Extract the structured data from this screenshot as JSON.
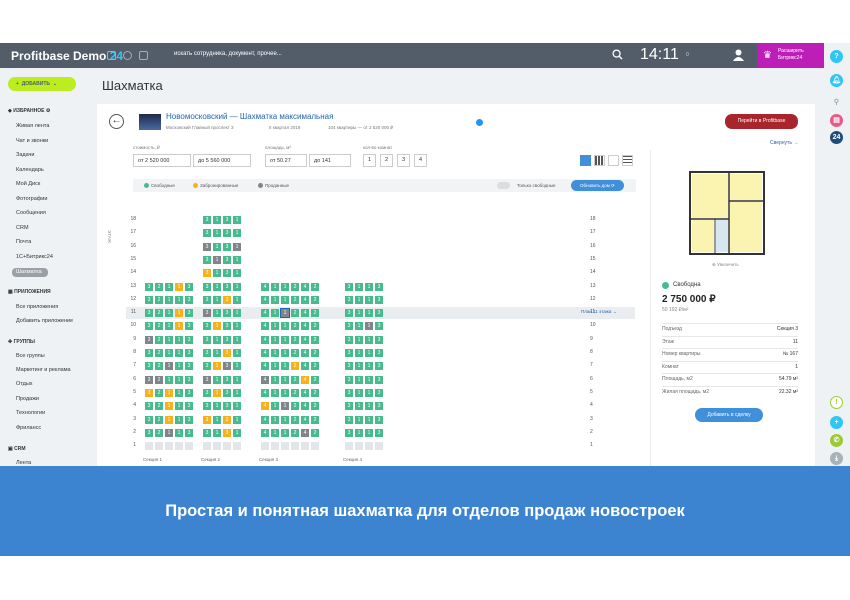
{
  "topbar": {
    "brand": "Profitbase Demo",
    "brand_num": "24",
    "search_placeholder": "искать сотрудника, документ, прочее...",
    "clock": "14:11",
    "clock_sub": "0",
    "expand_line1": "Расширить",
    "expand_line2": "Битрикс24"
  },
  "rightbar": {
    "help": "?",
    "b24": "24"
  },
  "sidebar": {
    "add_label": "ДОБАВИТЬ",
    "fav_head": "ИЗБРАННОЕ",
    "fav_items": [
      "Живая лента",
      "Чат и звонки",
      "Задачи",
      "Календарь",
      "Мой Диск",
      "Фотографии",
      "Сообщения",
      "CRM",
      "Почта",
      "1С+Битрикс24",
      "Шахматка"
    ],
    "apps_head": "ПРИЛОЖЕНИЯ",
    "apps_items": [
      "Все приложения",
      "Добавить приложение"
    ],
    "groups_head": "ГРУППЫ",
    "groups_items": [
      "Все группы",
      "Маркетинг и реклама",
      "Отдых",
      "Продажи",
      "Технологии",
      "Фрилансс"
    ],
    "crm_head": "CRM",
    "crm_items": [
      "Лента"
    ]
  },
  "page_title": "Шахматка",
  "project": {
    "title": "Новомосковский — Шахматка максимальная",
    "address": "Московский Главный проспект 3",
    "quarter": "II квартал 2019",
    "count": "104 квартиры",
    "from_price": "— от 2 520 000 ₽",
    "go_label": "Перейти в Profitbase",
    "collapse": "Свернуть"
  },
  "filters": {
    "cost_label": "стоимость, ₽",
    "cost_from": "от  2 520 000",
    "cost_to": "до  5 560 000",
    "area_label": "площадь, м²",
    "area_from": "от  50.27",
    "area_to": "до  141",
    "rooms_label": "кол-во комнат",
    "rooms": [
      "1",
      "2",
      "3",
      "4"
    ]
  },
  "legend": {
    "free": "Свободные",
    "reserved": "Забронированные",
    "sold": "Проданные",
    "only_free": "Только свободные",
    "update": "Обновить дом"
  },
  "colors": {
    "free": "#47ba8e",
    "reserved": "#f7b11c",
    "sold": "#7f8589",
    "empty": "#e3e6e9",
    "accent": "#3f8fda",
    "brand": "#bd1eb8",
    "banner": "#3d84d0"
  },
  "grid": {
    "floors_label": "ЭТАЖ",
    "floors": [
      "18",
      "17",
      "16",
      "15",
      "14",
      "13",
      "12",
      "11",
      "10",
      "9",
      "8",
      "7",
      "6",
      "5",
      "4",
      "3",
      "2",
      "1"
    ],
    "plan_label": "План 11 этажа  →",
    "sections": [
      "Секция 1",
      "Секция 2",
      "Секция 3",
      "Секция 4"
    ],
    "s1": [
      [],
      [],
      [],
      [],
      [],
      [
        "F3",
        "F2",
        "F1",
        "R1",
        "F3"
      ],
      [
        "F3",
        "F2",
        "F1",
        "F1",
        "F3"
      ],
      [
        "F3",
        "F2",
        "F1",
        "R1",
        "F3"
      ],
      [
        "F3",
        "F2",
        "F1",
        "R1",
        "F3"
      ],
      [
        "S3",
        "F2",
        "F1",
        "F1",
        "F3"
      ],
      [
        "F3",
        "F2",
        "F1",
        "F1",
        "F3"
      ],
      [
        "F3",
        "F2",
        "S1",
        "F1",
        "F3"
      ],
      [
        "S3",
        "S2",
        "F1",
        "F1",
        "F3"
      ],
      [
        "R3",
        "F2",
        "R1",
        "F1",
        "F3"
      ],
      [
        "F3",
        "F2",
        "R1",
        "F1",
        "F3"
      ],
      [
        "F3",
        "F2",
        "R1",
        "F1",
        "F3"
      ],
      [
        "F3",
        "F2",
        "S1",
        "F1",
        "F3"
      ],
      [
        "E",
        "E",
        "E",
        "E",
        "E"
      ]
    ],
    "s2": [
      [
        "F3",
        "F1",
        "F3",
        "F1"
      ],
      [
        "F3",
        "F1",
        "F3",
        "F1"
      ],
      [
        "S3",
        "F1",
        "F3",
        "S1"
      ],
      [
        "F3",
        "S1",
        "F3",
        "F1"
      ],
      [
        "R3",
        "F1",
        "F3",
        "F1"
      ],
      [
        "F3",
        "F1",
        "F3",
        "F1"
      ],
      [
        "F3",
        "F1",
        "R3",
        "F1"
      ],
      [
        "S3",
        "F1",
        "F3",
        "F1"
      ],
      [
        "F3",
        "R1",
        "F3",
        "F1"
      ],
      [
        "F3",
        "F1",
        "F3",
        "F1"
      ],
      [
        "F3",
        "F1",
        "R3",
        "F1"
      ],
      [
        "F3",
        "R1",
        "S3",
        "F1"
      ],
      [
        "S3",
        "F1",
        "F3",
        "F1"
      ],
      [
        "F3",
        "R1",
        "F3",
        "F1"
      ],
      [
        "F3",
        "F1",
        "F3",
        "F1"
      ],
      [
        "R3",
        "F1",
        "R3",
        "F1"
      ],
      [
        "F3",
        "F1",
        "R3",
        "F1"
      ],
      [
        "E",
        "E",
        "E",
        "E"
      ]
    ],
    "s3": [
      [],
      [],
      [],
      [],
      [],
      [
        "F4",
        "F1",
        "F1",
        "F2",
        "F4",
        "F2"
      ],
      [
        "F4",
        "F1",
        "F1",
        "F2",
        "F4",
        "F2"
      ],
      [
        "F4",
        "F1",
        "S1",
        "F2",
        "F4",
        "F2"
      ],
      [
        "F4",
        "F1",
        "F1",
        "F2",
        "F4",
        "F2"
      ],
      [
        "F4",
        "F1",
        "F1",
        "F2",
        "F4",
        "F2"
      ],
      [
        "F4",
        "F1",
        "F1",
        "F2",
        "F4",
        "F2"
      ],
      [
        "F4",
        "F1",
        "F1",
        "R2",
        "F4",
        "F2"
      ],
      [
        "S4",
        "F1",
        "F1",
        "F2",
        "R4",
        "F2"
      ],
      [
        "F4",
        "F1",
        "F1",
        "F2",
        "F4",
        "F2"
      ],
      [
        "R4",
        "F1",
        "S1",
        "F2",
        "F4",
        "F2"
      ],
      [
        "F4",
        "F1",
        "F1",
        "F2",
        "F4",
        "F2"
      ],
      [
        "F4",
        "F1",
        "F1",
        "F2",
        "S4",
        "F2"
      ],
      [
        "E",
        "E",
        "E",
        "E",
        "E",
        "E"
      ]
    ],
    "s4": [
      [],
      [],
      [],
      [],
      [],
      [
        "F3",
        "F1",
        "F1",
        "F3"
      ],
      [
        "F3",
        "F1",
        "F1",
        "F3"
      ],
      [
        "F3",
        "F1",
        "F1",
        "F3"
      ],
      [
        "F3",
        "F1",
        "S1",
        "F3"
      ],
      [
        "F3",
        "F1",
        "F1",
        "F3"
      ],
      [
        "F3",
        "F1",
        "F1",
        "F3"
      ],
      [
        "F3",
        "F1",
        "F1",
        "F3"
      ],
      [
        "F3",
        "F1",
        "F1",
        "F3"
      ],
      [
        "F3",
        "F1",
        "F1",
        "F3"
      ],
      [
        "F3",
        "F1",
        "F1",
        "F3"
      ],
      [
        "F3",
        "F1",
        "F1",
        "F3"
      ],
      [
        "F3",
        "F1",
        "F1",
        "F3"
      ],
      [
        "E",
        "E",
        "E",
        "E"
      ]
    ]
  },
  "detail": {
    "zoom": "Увеличить",
    "status": "Свободна",
    "price": "2 750 000 ₽",
    "price_per_m": "50 192 ₽/м²",
    "rows": [
      {
        "k": "Подъезд",
        "v": "Секция 3"
      },
      {
        "k": "Этаж",
        "v": "11"
      },
      {
        "k": "Номер квартиры",
        "v": "№ 167"
      },
      {
        "k": "Комнат",
        "v": "1"
      },
      {
        "k": "Площадь, м2",
        "v": "54.79 м²"
      },
      {
        "k": "Жилая площадь, м2",
        "v": "22.32 м²"
      }
    ],
    "add_deal": "Добавить в сделку"
  },
  "banner": "Простая и понятная шахматка для отделов продаж новостроек"
}
